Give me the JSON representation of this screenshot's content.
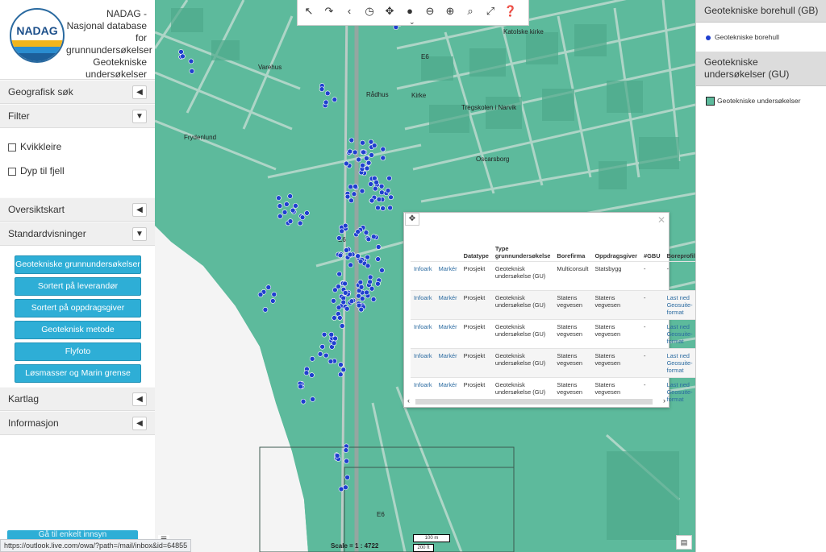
{
  "app": {
    "logo_text": "NADAG",
    "title": "NADAG - Nasjonal database for grunnundersøkelser Geotekniske undersøkelser"
  },
  "sidebar": {
    "geo_search": "Geografisk søk",
    "filter": "Filter",
    "filter_options": [
      "Kvikkleire",
      "Dyp til fjell"
    ],
    "overview_map": "Oversiktskart",
    "standard_views": "Standardvisninger",
    "standard_buttons": [
      "Geotekniske grunnundersøkelser",
      "Sortert på leverandør",
      "Sortert på oppdragsgiver",
      "Geoteknisk metode",
      "Flyfoto",
      "Løsmasser og Marin grense"
    ],
    "map_layers": "Kartlag",
    "information": "Informasjon",
    "goto_button": "Gå til enkelt innsyn"
  },
  "statusbar": {
    "url": "https://outlook.live.com/owa/?path=/mail/inbox&id=64855"
  },
  "map": {
    "labels": [
      "Varehus",
      "Frydenlund",
      "Rådhus",
      "Kirke",
      "Katolske kirke",
      "Oscarsborg",
      "E6",
      "E6",
      "E6",
      "Tregskolen i Narvik"
    ],
    "scale_text": "Scale = 1 : 4722",
    "scalebar_m": "100 m",
    "scalebar_ft": "200 ft",
    "colors": {
      "zone": "#5dba9c",
      "points": "#1f3fcf"
    }
  },
  "popup": {
    "columns": [
      "",
      "",
      "Datatype",
      "Type grunnundersøkelse",
      "Borefirma",
      "Oppdragsgiver",
      "#GBU",
      "Boreprofil"
    ],
    "rows": [
      {
        "info": "Infoark",
        "mark": "Markér",
        "datatype": "Prosjekt",
        "type": "Geoteknisk undersøkelse (GU)",
        "firm": "Multiconsult",
        "client": "Statsbygg",
        "gbu": "-",
        "profile": "-"
      },
      {
        "info": "Infoark",
        "mark": "Markér",
        "datatype": "Prosjekt",
        "type": "Geoteknisk undersøkelse (GU)",
        "firm": "Statens vegvesen",
        "client": "Statens vegvesen",
        "gbu": "-",
        "profile": "Last ned Geosuite-format"
      },
      {
        "info": "Infoark",
        "mark": "Markér",
        "datatype": "Prosjekt",
        "type": "Geoteknisk undersøkelse (GU)",
        "firm": "Statens vegvesen",
        "client": "Statens vegvesen",
        "gbu": "-",
        "profile": "Last ned Geosuite-format"
      },
      {
        "info": "Infoark",
        "mark": "Markér",
        "datatype": "Prosjekt",
        "type": "Geoteknisk undersøkelse (GU)",
        "firm": "Statens vegvesen",
        "client": "Statens vegvesen",
        "gbu": "-",
        "profile": "Last ned Geosuite-format"
      },
      {
        "info": "Infoark",
        "mark": "Markér",
        "datatype": "Prosjekt",
        "type": "Geoteknisk undersøkelse (GU)",
        "firm": "Statens vegvesen",
        "client": "Statens vegvesen",
        "gbu": "-",
        "profile": "Last ned Geosuite-format"
      }
    ]
  },
  "legend": {
    "boreholes_header": "Geotekniske borehull (GB)",
    "boreholes_item": "Geotekniske borehull",
    "surveys_header": "Geotekniske undersøkelser (GU)",
    "surveys_item": "Geotekniske undersøkelser"
  }
}
